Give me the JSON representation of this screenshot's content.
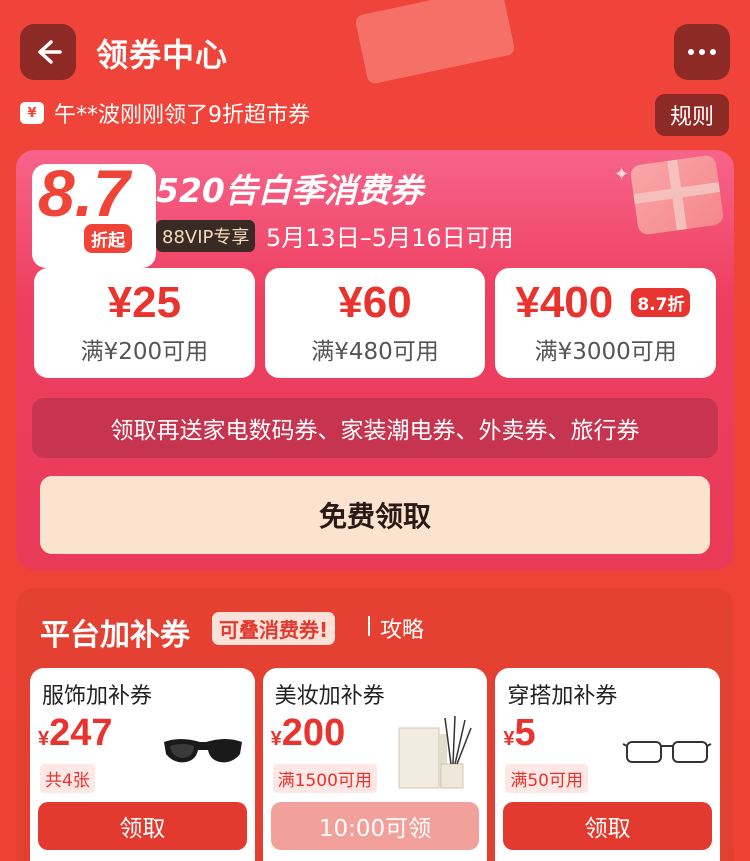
{
  "header": {
    "title": "领券中心",
    "back_icon": "back-arrow-icon",
    "more_icon": "more-dots-icon"
  },
  "ticker": {
    "icon": "coupon-icon",
    "text": "午**波刚刚领了9折超市券"
  },
  "rules_label": "规则",
  "main_coupon": {
    "badge_value": "8.7",
    "badge_tag": "折起",
    "title": "520告白季消费券",
    "vip_tag": "88VIP专享",
    "date_range": "5月13日–5月16日可用",
    "coupons": [
      {
        "amount": "¥25",
        "condition": "满¥200可用",
        "discount": ""
      },
      {
        "amount": "¥60",
        "condition": "满¥480可用",
        "discount": ""
      },
      {
        "amount": "¥400",
        "condition": "满¥3000可用",
        "discount": "8.7折"
      }
    ],
    "bonus_text": "领取再送家电数码券、家装潮电券、外卖券、旅行券",
    "claim_label": "免费领取"
  },
  "platform": {
    "title": "平台加补券",
    "tag": "可叠消费券!",
    "guide": "攻略",
    "cards": [
      {
        "name": "服饰加补券",
        "yen": "¥",
        "value": "247",
        "note": "共4张",
        "button": "领取",
        "image": "sunglasses-icon"
      },
      {
        "name": "美妆加补券",
        "yen": "¥",
        "value": "200",
        "note": "满1500可用",
        "button": "10:00可领",
        "image": "perfume-icon"
      },
      {
        "name": "穿搭加补券",
        "yen": "¥",
        "value": "5",
        "note": "满50可用",
        "button": "领取",
        "image": "eyeglasses-icon"
      }
    ]
  },
  "colors": {
    "background": "#ef4437",
    "accent_red": "#e8332f",
    "card_pink": "#ee3f60",
    "dark_button": "#8e2a25",
    "claim_button": "#fbe3cf"
  }
}
